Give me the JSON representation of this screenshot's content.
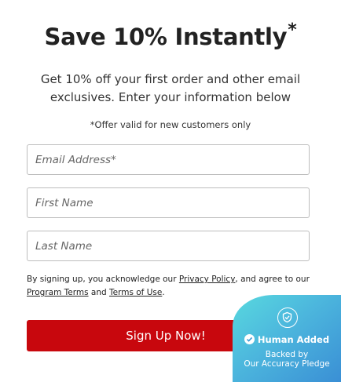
{
  "header": {
    "title": "Save 10% Instantly",
    "title_mark": "*",
    "subtitle": "Get 10% off your first order and other email exclusives. Enter your information below",
    "offer_note": "*Offer valid for new customers only"
  },
  "form": {
    "email_placeholder": "Email Address*",
    "first_name_placeholder": "First Name",
    "last_name_placeholder": "Last Name",
    "submit_label": "Sign Up Now!"
  },
  "legal": {
    "text_1": "By signing up, you acknowledge our ",
    "privacy_link": "Privacy Policy",
    "text_2": ", and agree to our ",
    "terms_link": "Program Terms",
    "text_3": " and ",
    "use_link": "Terms of Use",
    "text_4": "."
  },
  "badge": {
    "icon": "shield-check-icon",
    "title": "Human Added",
    "line_1": "Backed by",
    "line_2": "Our Accuracy Pledge",
    "colors": [
      "#58d9df",
      "#3a8fd5"
    ]
  },
  "colors": {
    "accent": "#c8070d"
  }
}
